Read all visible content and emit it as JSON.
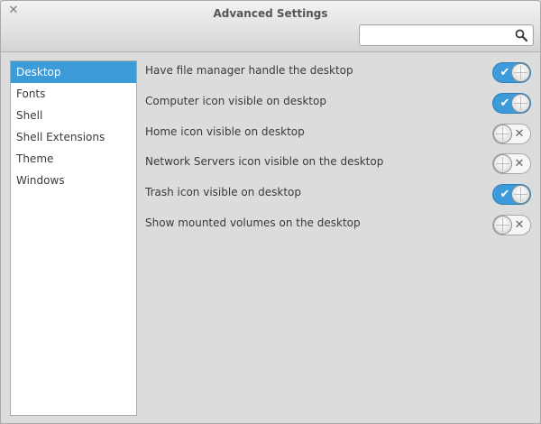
{
  "window": {
    "title": "Advanced Settings",
    "close_glyph": "✕"
  },
  "search": {
    "value": "",
    "placeholder": "",
    "icon": "search-icon"
  },
  "sidebar": {
    "items": [
      {
        "label": "Desktop",
        "selected": true
      },
      {
        "label": "Fonts",
        "selected": false
      },
      {
        "label": "Shell",
        "selected": false
      },
      {
        "label": "Shell Extensions",
        "selected": false
      },
      {
        "label": "Theme",
        "selected": false
      },
      {
        "label": "Windows",
        "selected": false
      }
    ]
  },
  "settings": {
    "rows": [
      {
        "label": "Have file manager handle the desktop",
        "enabled": true
      },
      {
        "label": "Computer icon visible on desktop",
        "enabled": true
      },
      {
        "label": "Home icon visible on desktop",
        "enabled": false
      },
      {
        "label": "Network Servers icon visible on the desktop",
        "enabled": false
      },
      {
        "label": "Trash icon visible on desktop",
        "enabled": true
      },
      {
        "label": "Show mounted volumes on the desktop",
        "enabled": false
      }
    ]
  },
  "colors": {
    "accent": "#3d9bda",
    "background": "#dcdcdc"
  }
}
